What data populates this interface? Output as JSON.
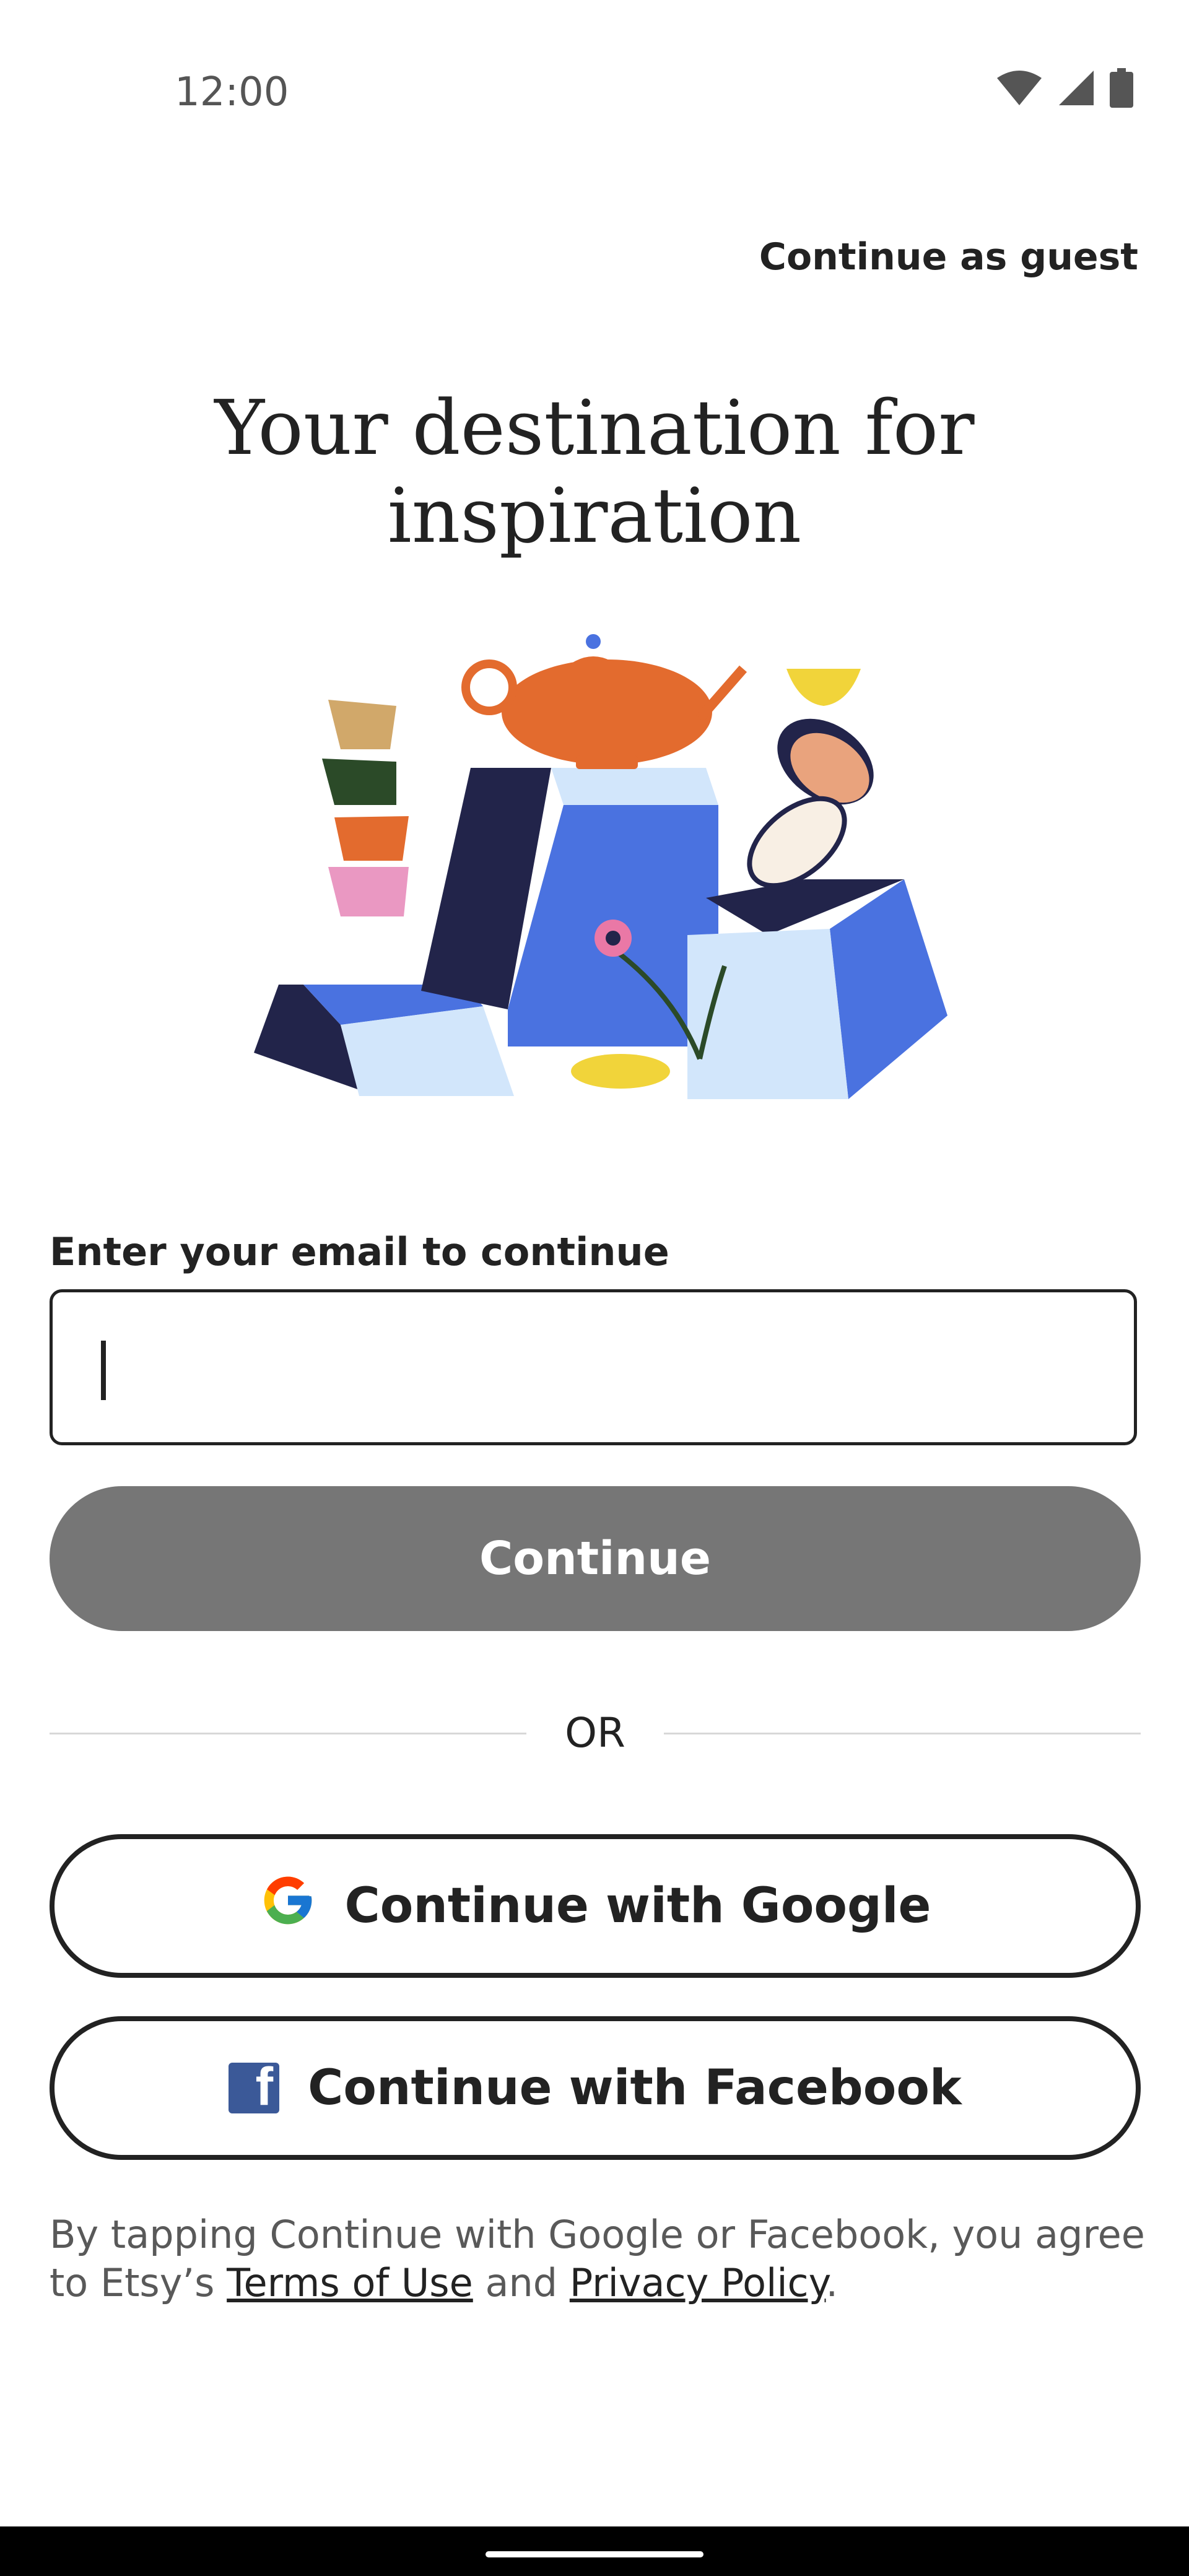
{
  "status_bar": {
    "time": "12:00",
    "icons": [
      "wifi-icon",
      "cellular-signal-icon",
      "battery-icon"
    ]
  },
  "header": {
    "guest_link": "Continue as guest"
  },
  "hero": {
    "headline": "Your destination for inspiration",
    "illustration": "ceramics-pedestals-illustration"
  },
  "form": {
    "email_label": "Enter your email to continue",
    "email_value": "",
    "continue_label": "Continue"
  },
  "divider": {
    "text": "OR"
  },
  "social": {
    "google_label": "Continue with Google",
    "google_icon": "google-logo-icon",
    "facebook_label": "Continue with Facebook",
    "facebook_icon": "facebook-logo-icon"
  },
  "legal": {
    "prefix": "By tapping Continue with Google or Facebook, you agree to Etsy’s ",
    "terms_link": "Terms of Use",
    "and": " and ",
    "privacy_link": "Privacy Policy",
    "suffix": "."
  },
  "colors": {
    "text": "#222222",
    "continue_button_disabled": "#767676",
    "facebook_blue": "#3b5998",
    "illustration_blue": "#4a72e0",
    "illustration_navy": "#22244a",
    "illustration_orange": "#e36b2e"
  }
}
